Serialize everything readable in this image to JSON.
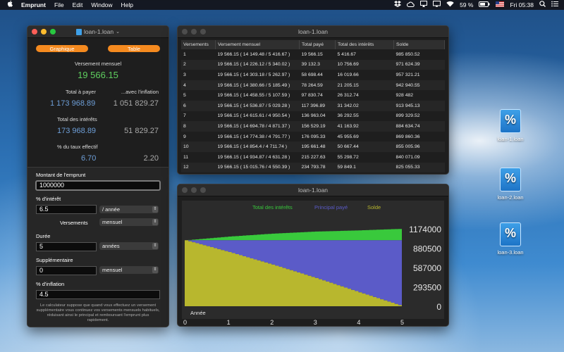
{
  "menubar": {
    "apple": "",
    "app": "Emprunt",
    "items": [
      "File",
      "Edit",
      "Window",
      "Help"
    ],
    "battery": "59 %",
    "clock": "Fri 05:38"
  },
  "calc": {
    "title": "loan-1.loan",
    "graph_btn": "Graphique",
    "table_btn": "Table",
    "monthly_label": "Versement mensuel",
    "monthly_value": "19 566.15",
    "total_pay_label": "Total à payer",
    "inflation_label": "...avec l'inflation",
    "total_pay_value": "1 173 968.89",
    "total_pay_infl": "1 051 829.27",
    "total_int_label": "Total des intérêts",
    "total_int_value": "173 968.89",
    "total_int_infl": "51 829.27",
    "rate_label": "% du taux effectif",
    "rate_value": "6.70",
    "rate_infl": "2.20",
    "loan_label": "Montant de l'emprunt",
    "loan_value": "1000000",
    "interest_label": "% d'intérêt",
    "interest_value": "6.5",
    "interest_unit": "/ année",
    "payments_label": "Versements",
    "payments_value": "mensuel",
    "duration_label": "Durée",
    "duration_value": "5",
    "duration_unit": "années",
    "extra_label": "Supplémentaire",
    "extra_value": "0",
    "extra_unit": "mensuel",
    "inflation_pct_label": "% d'inflation",
    "inflation_pct_value": "4.5",
    "note": "Le calculateur suppose que quand vous effectuez un versement supplémentaire vous continuez vos versements mensuels habituels, réduisant ainsi le principal et remboursant l'emprunt plus rapidement."
  },
  "table": {
    "title": "loan-1.loan",
    "headers": [
      "Versements",
      "Versement mensuel",
      "Total payé",
      "Total des intérêts",
      "Solde"
    ],
    "rows": [
      [
        "1",
        "19 566.15 ( 14 149.48 / 5 416.67 )",
        "19 566.15",
        "5 416.67",
        "985 850.52"
      ],
      [
        "2",
        "19 566.15 ( 14 226.12 / 5 340.02 )",
        "39 132.3",
        "10 756.69",
        "971 624.39"
      ],
      [
        "3",
        "19 566.15 ( 14 303.18 / 5 262.97 )",
        "58 698.44",
        "16 019.66",
        "957 321.21"
      ],
      [
        "4",
        "19 566.15 ( 14 380.66 / 5 185.49 )",
        "78 264.59",
        "21 205.15",
        "942 940.55"
      ],
      [
        "5",
        "19 566.15 ( 14 458.55 / 5 107.59 )",
        "97 830.74",
        "26 312.74",
        "928 482"
      ],
      [
        "6",
        "19 566.15 ( 14 536.87 / 5 029.28 )",
        "117 396.89",
        "31 342.02",
        "913 945.13"
      ],
      [
        "7",
        "19 566.15 ( 14 615.61 / 4 950.54 )",
        "136 963.04",
        "36 292.55",
        "899 329.52"
      ],
      [
        "8",
        "19 566.15 ( 14 694.78 / 4 871.37 )",
        "156 529.19",
        "41 163.92",
        "884 634.74"
      ],
      [
        "9",
        "19 566.15 ( 14 774.38 / 4 791.77 )",
        "176 095.33",
        "45 955.69",
        "869 860.36"
      ],
      [
        "10",
        "19 566.15 ( 14 854.4 / 4 711.74 )",
        "195 661.48",
        "50 667.44",
        "855 005.96"
      ],
      [
        "11",
        "19 566.15 ( 14 934.87 / 4 631.28 )",
        "215 227.63",
        "55 298.72",
        "840 071.09"
      ],
      [
        "12",
        "19 566.15 ( 15 015.76 / 4 550.39 )",
        "234 793.78",
        "59 849.1",
        "825 055.33"
      ]
    ]
  },
  "chart_window_title": "loan-1.loan",
  "chart_data": {
    "type": "area",
    "legend": [
      "Total des intérêts",
      "Principal payé",
      "Solde"
    ],
    "colors": {
      "interest": "#39c93c",
      "principal": "#5b5bc8",
      "balance": "#b8b72e"
    },
    "xlabel": "Année",
    "x_ticks": [
      "0",
      "1",
      "2",
      "3",
      "4",
      "5"
    ],
    "y_ticks": [
      "1174000",
      "880500",
      "587000",
      "293500",
      "0"
    ],
    "ylim": [
      0,
      1174000
    ],
    "xlim": [
      0,
      5
    ],
    "x": [
      0,
      1,
      2,
      3,
      4,
      5
    ],
    "series": [
      {
        "name": "Solde",
        "values": [
          1000000,
          821500,
          631000,
          428000,
          211000,
          0
        ]
      },
      {
        "name": "Principal payé",
        "values": [
          0,
          178500,
          369000,
          572000,
          789000,
          1000000
        ]
      },
      {
        "name": "Total des intérêts",
        "values": [
          0,
          56300,
          100700,
          132400,
          150100,
          173969
        ]
      }
    ]
  },
  "desktop": {
    "icons": [
      "loan-1.loan",
      "loan-2.loan",
      "loan-3.loan"
    ]
  }
}
